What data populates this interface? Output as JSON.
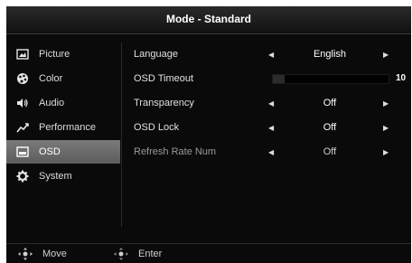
{
  "header": {
    "title": "Mode - Standard"
  },
  "sidebar": {
    "items": [
      {
        "label": "Picture",
        "icon": "picture-icon",
        "active": false
      },
      {
        "label": "Color",
        "icon": "color-palette-icon",
        "active": false
      },
      {
        "label": "Audio",
        "icon": "speaker-icon",
        "active": false
      },
      {
        "label": "Performance",
        "icon": "performance-graph-icon",
        "active": false
      },
      {
        "label": "OSD",
        "icon": "osd-monitor-icon",
        "active": true
      },
      {
        "label": "System",
        "icon": "gear-icon",
        "active": false
      }
    ]
  },
  "settings": [
    {
      "name": "Language",
      "value": "English",
      "dim": false
    },
    {
      "name": "OSD Timeout",
      "value": "10",
      "slider_fraction": 0.1,
      "dim": false
    },
    {
      "name": "Transparency",
      "value": "Off",
      "dim": false
    },
    {
      "name": "OSD Lock",
      "value": "Off",
      "dim": false
    },
    {
      "name": "Refresh Rate Num",
      "value": "Off",
      "dim": true
    }
  ],
  "footer": {
    "move_label": "Move",
    "enter_label": "Enter"
  },
  "colors": {
    "background": "#0a0a0a",
    "active_item": "#6a6a6a",
    "text": "#e0e0e0"
  }
}
